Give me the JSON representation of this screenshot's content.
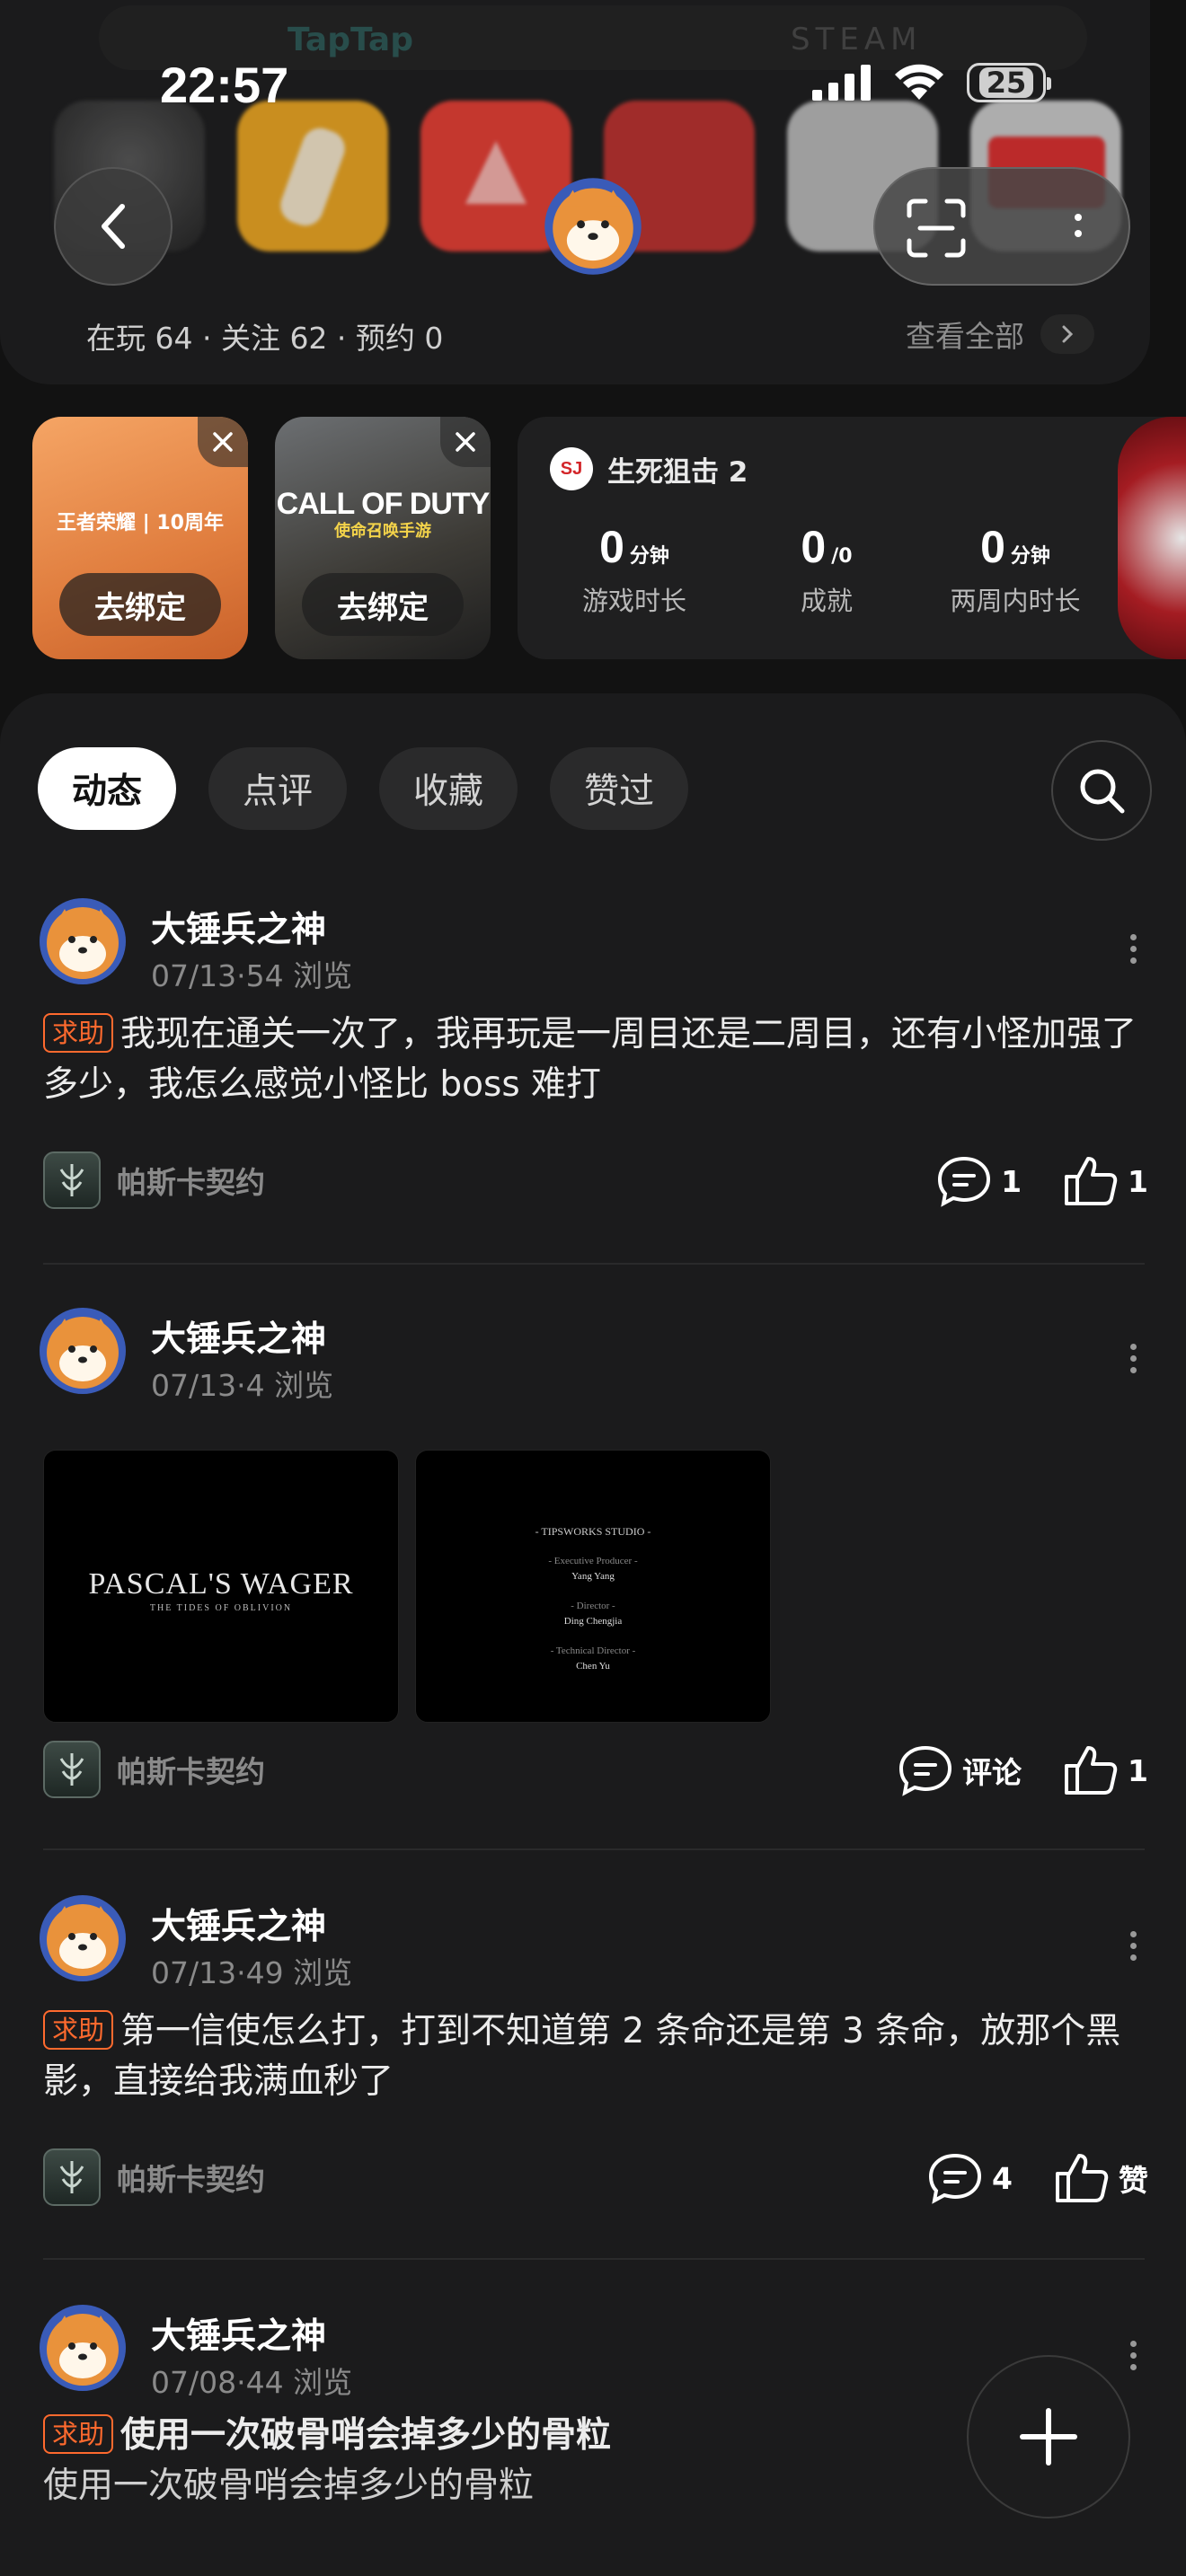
{
  "status_bar": {
    "time": "22:57",
    "battery": "25"
  },
  "ghost_tabs": [
    "TapTap",
    "STEAM"
  ],
  "profile_header": {
    "stats_line": "在玩 64 · 关注 62 · 预约 0",
    "view_all": "查看全部"
  },
  "bind_cards": [
    {
      "brand": "王者荣耀 | 10周年",
      "button": "去绑定"
    },
    {
      "brand": "CALL OF DUTY",
      "brand_sub": "使命召唤手游",
      "button": "去绑定"
    }
  ],
  "game_stats": {
    "game_name": "生死狙击 2",
    "logo_text": "SJ",
    "items": [
      {
        "value": "0",
        "unit": "分钟",
        "label": "游戏时长"
      },
      {
        "value": "0",
        "unit": "/0",
        "label": "成就"
      },
      {
        "value": "0",
        "unit": "分钟",
        "label": "两周内时长"
      }
    ]
  },
  "tabs": [
    {
      "label": "动态",
      "active": true
    },
    {
      "label": "点评",
      "active": false
    },
    {
      "label": "收藏",
      "active": false
    },
    {
      "label": "赞过",
      "active": false
    }
  ],
  "posts": [
    {
      "author": "大锤兵之神",
      "meta": "07/13·54 浏览",
      "tag": "求助",
      "text": "我现在通关一次了，我再玩是一周目还是二周目，还有小怪加强了多少，我怎么感觉小怪比 boss 难打",
      "circle": "帕斯卡契约",
      "comments": "1",
      "likes": "1"
    },
    {
      "author": "大锤兵之神",
      "meta": "07/13·4 浏览",
      "images": [
        {
          "title": "PASCAL'S WAGER",
          "subtitle": "THE TIDES OF OBLIVION"
        },
        {
          "credits": [
            "- TIPSWORKS STUDIO -",
            "- Executive Producer -",
            "Yang Yang",
            "- Director -",
            "Ding Chengjia",
            "- Technical Director -",
            "Chen Yu"
          ]
        }
      ],
      "circle": "帕斯卡契约",
      "comments": "评论",
      "likes": "1"
    },
    {
      "author": "大锤兵之神",
      "meta": "07/13·49 浏览",
      "tag": "求助",
      "text": "第一信使怎么打，打到不知道第 2 条命还是第 3 条命，放那个黑影，直接给我满血秒了",
      "circle": "帕斯卡契约",
      "comments": "4",
      "likes": "赞"
    },
    {
      "author": "大锤兵之神",
      "meta": "07/08·44 浏览",
      "tag": "求助",
      "title": "使用一次破骨哨会掉多少的骨粒",
      "text": "使用一次破骨哨会掉多少的骨粒"
    }
  ],
  "icons": {
    "back": "chevron-left-icon",
    "scan": "scan-icon",
    "more": "more-vertical-icon",
    "search": "search-icon",
    "comment": "comment-icon",
    "like": "thumbs-up-icon",
    "add": "plus-icon"
  },
  "colors": {
    "accent_tag": "#ff6a2e",
    "background": "#121212",
    "card": "#1b1b1c"
  }
}
